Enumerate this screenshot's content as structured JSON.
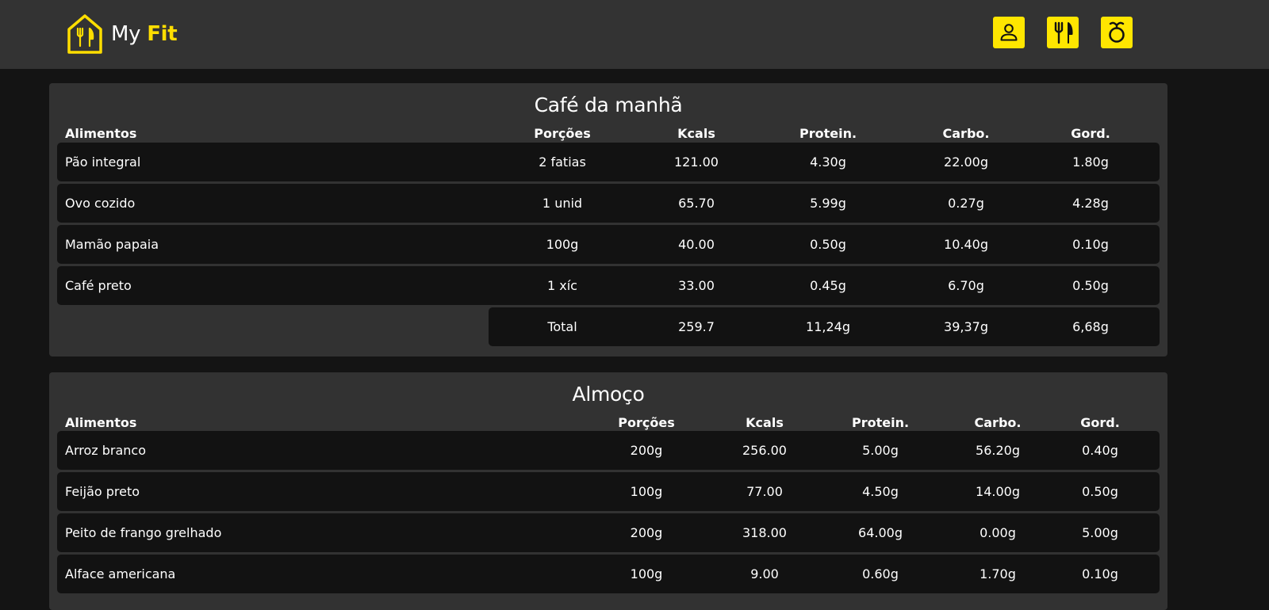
{
  "header": {
    "brand_prefix": "My",
    "brand_highlight": "Fit",
    "icons": [
      "home-utensils-logo-icon",
      "user-icon",
      "utensils-icon",
      "apple-icon"
    ],
    "accent_color": "#ffe600"
  },
  "meals": [
    {
      "title": "Café da manhã",
      "columns": [
        "Alimentos",
        "Porções",
        "Kcals",
        "Protein.",
        "Carbo.",
        "Gord."
      ],
      "rows": [
        {
          "food": "Pão integral",
          "portion": "2 fatias",
          "kcal": "121.00",
          "protein": "4.30g",
          "carbs": "22.00g",
          "fat": "1.80g"
        },
        {
          "food": "Ovo cozido",
          "portion": "1 unid",
          "kcal": "65.70",
          "protein": "5.99g",
          "carbs": "0.27g",
          "fat": "4.28g"
        },
        {
          "food": "Mamão papaia",
          "portion": "100g",
          "kcal": "40.00",
          "protein": "0.50g",
          "carbs": "10.40g",
          "fat": "0.10g"
        },
        {
          "food": "Café preto",
          "portion": "1 xíc",
          "kcal": "33.00",
          "protein": "0.45g",
          "carbs": "6.70g",
          "fat": "0.50g"
        }
      ],
      "total": {
        "label": "Total",
        "kcal": "259.7",
        "protein": "11,24g",
        "carbs": "39,37g",
        "fat": "6,68g"
      }
    },
    {
      "title": "Almoço",
      "columns": [
        "Alimentos",
        "Porções",
        "Kcals",
        "Protein.",
        "Carbo.",
        "Gord."
      ],
      "rows": [
        {
          "food": "Arroz branco",
          "portion": "200g",
          "kcal": "256.00",
          "protein": "5.00g",
          "carbs": "56.20g",
          "fat": "0.40g"
        },
        {
          "food": "Feijão preto",
          "portion": "100g",
          "kcal": "77.00",
          "protein": "4.50g",
          "carbs": "14.00g",
          "fat": "0.50g"
        },
        {
          "food": "Peito de frango grelhado",
          "portion": "200g",
          "kcal": "318.00",
          "protein": "64.00g",
          "carbs": "0.00g",
          "fat": "5.00g"
        },
        {
          "food": "Alface americana",
          "portion": "100g",
          "kcal": "9.00",
          "protein": "0.60g",
          "carbs": "1.70g",
          "fat": "0.10g"
        }
      ]
    }
  ]
}
